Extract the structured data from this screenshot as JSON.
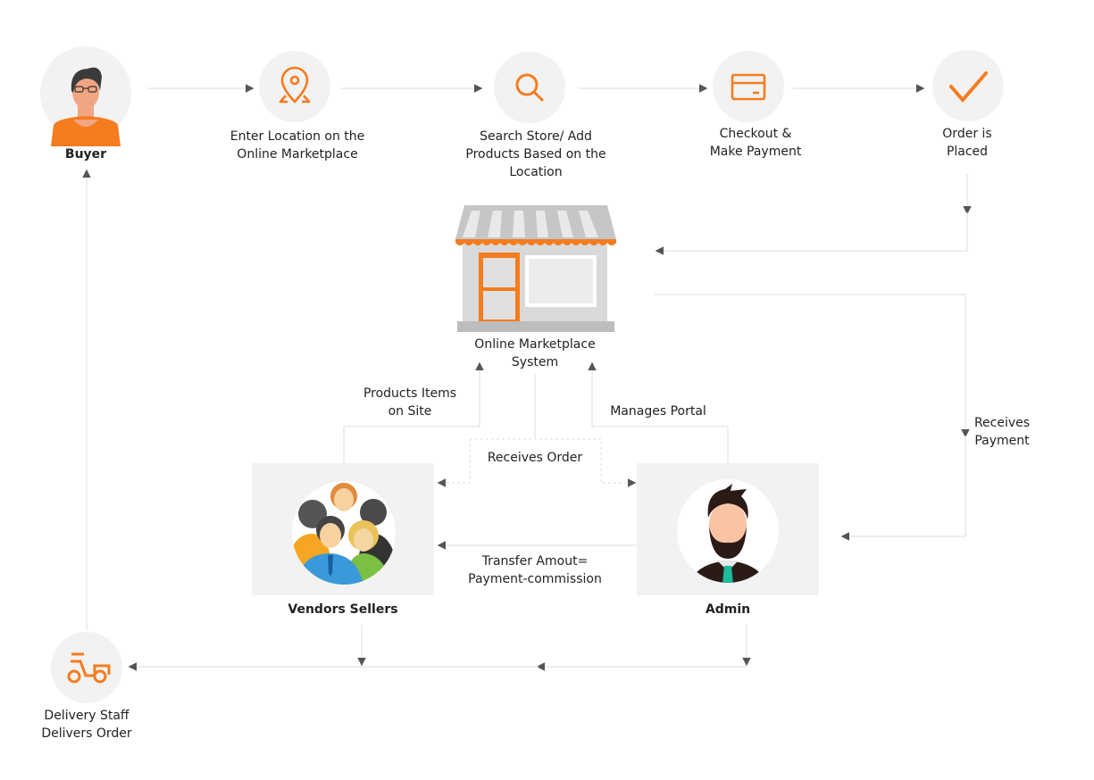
{
  "colors": {
    "accent": "#f57c1f",
    "circle_bg": "#f2f2f2",
    "line": "#e3e3e3",
    "arrow": "#555555"
  },
  "nodes": {
    "buyer": {
      "label": "Buyer",
      "icon": "buyer-avatar"
    },
    "enter_location": {
      "lines": [
        "Enter Location on the",
        "Online Marketplace"
      ],
      "icon": "location-pin-icon"
    },
    "search_store": {
      "lines": [
        "Search Store/ Add",
        "Products Based on the",
        "Location"
      ],
      "icon": "search-icon"
    },
    "checkout": {
      "lines": [
        "Checkout &",
        "Make Payment"
      ],
      "icon": "credit-card-icon"
    },
    "order_placed": {
      "lines": [
        "Order is",
        "Placed"
      ],
      "icon": "checkmark-icon"
    },
    "marketplace": {
      "lines": [
        "Online Marketplace",
        "System"
      ],
      "icon": "storefront-icon"
    },
    "vendors": {
      "label": "Vendors Sellers",
      "icon": "vendors-group-avatar"
    },
    "admin": {
      "label": "Admin",
      "icon": "admin-avatar"
    },
    "delivery": {
      "lines": [
        "Delivery Staff",
        "Delivers Order"
      ],
      "icon": "scooter-icon"
    }
  },
  "edges": {
    "products_items": [
      "Products Items",
      "on Site"
    ],
    "manages_portal": "Manages Portal",
    "receives_order": "Receives Order",
    "receives_payment": [
      "Receives",
      "Payment"
    ],
    "transfer_amount": [
      "Transfer Amout=",
      "Payment-commission"
    ]
  }
}
